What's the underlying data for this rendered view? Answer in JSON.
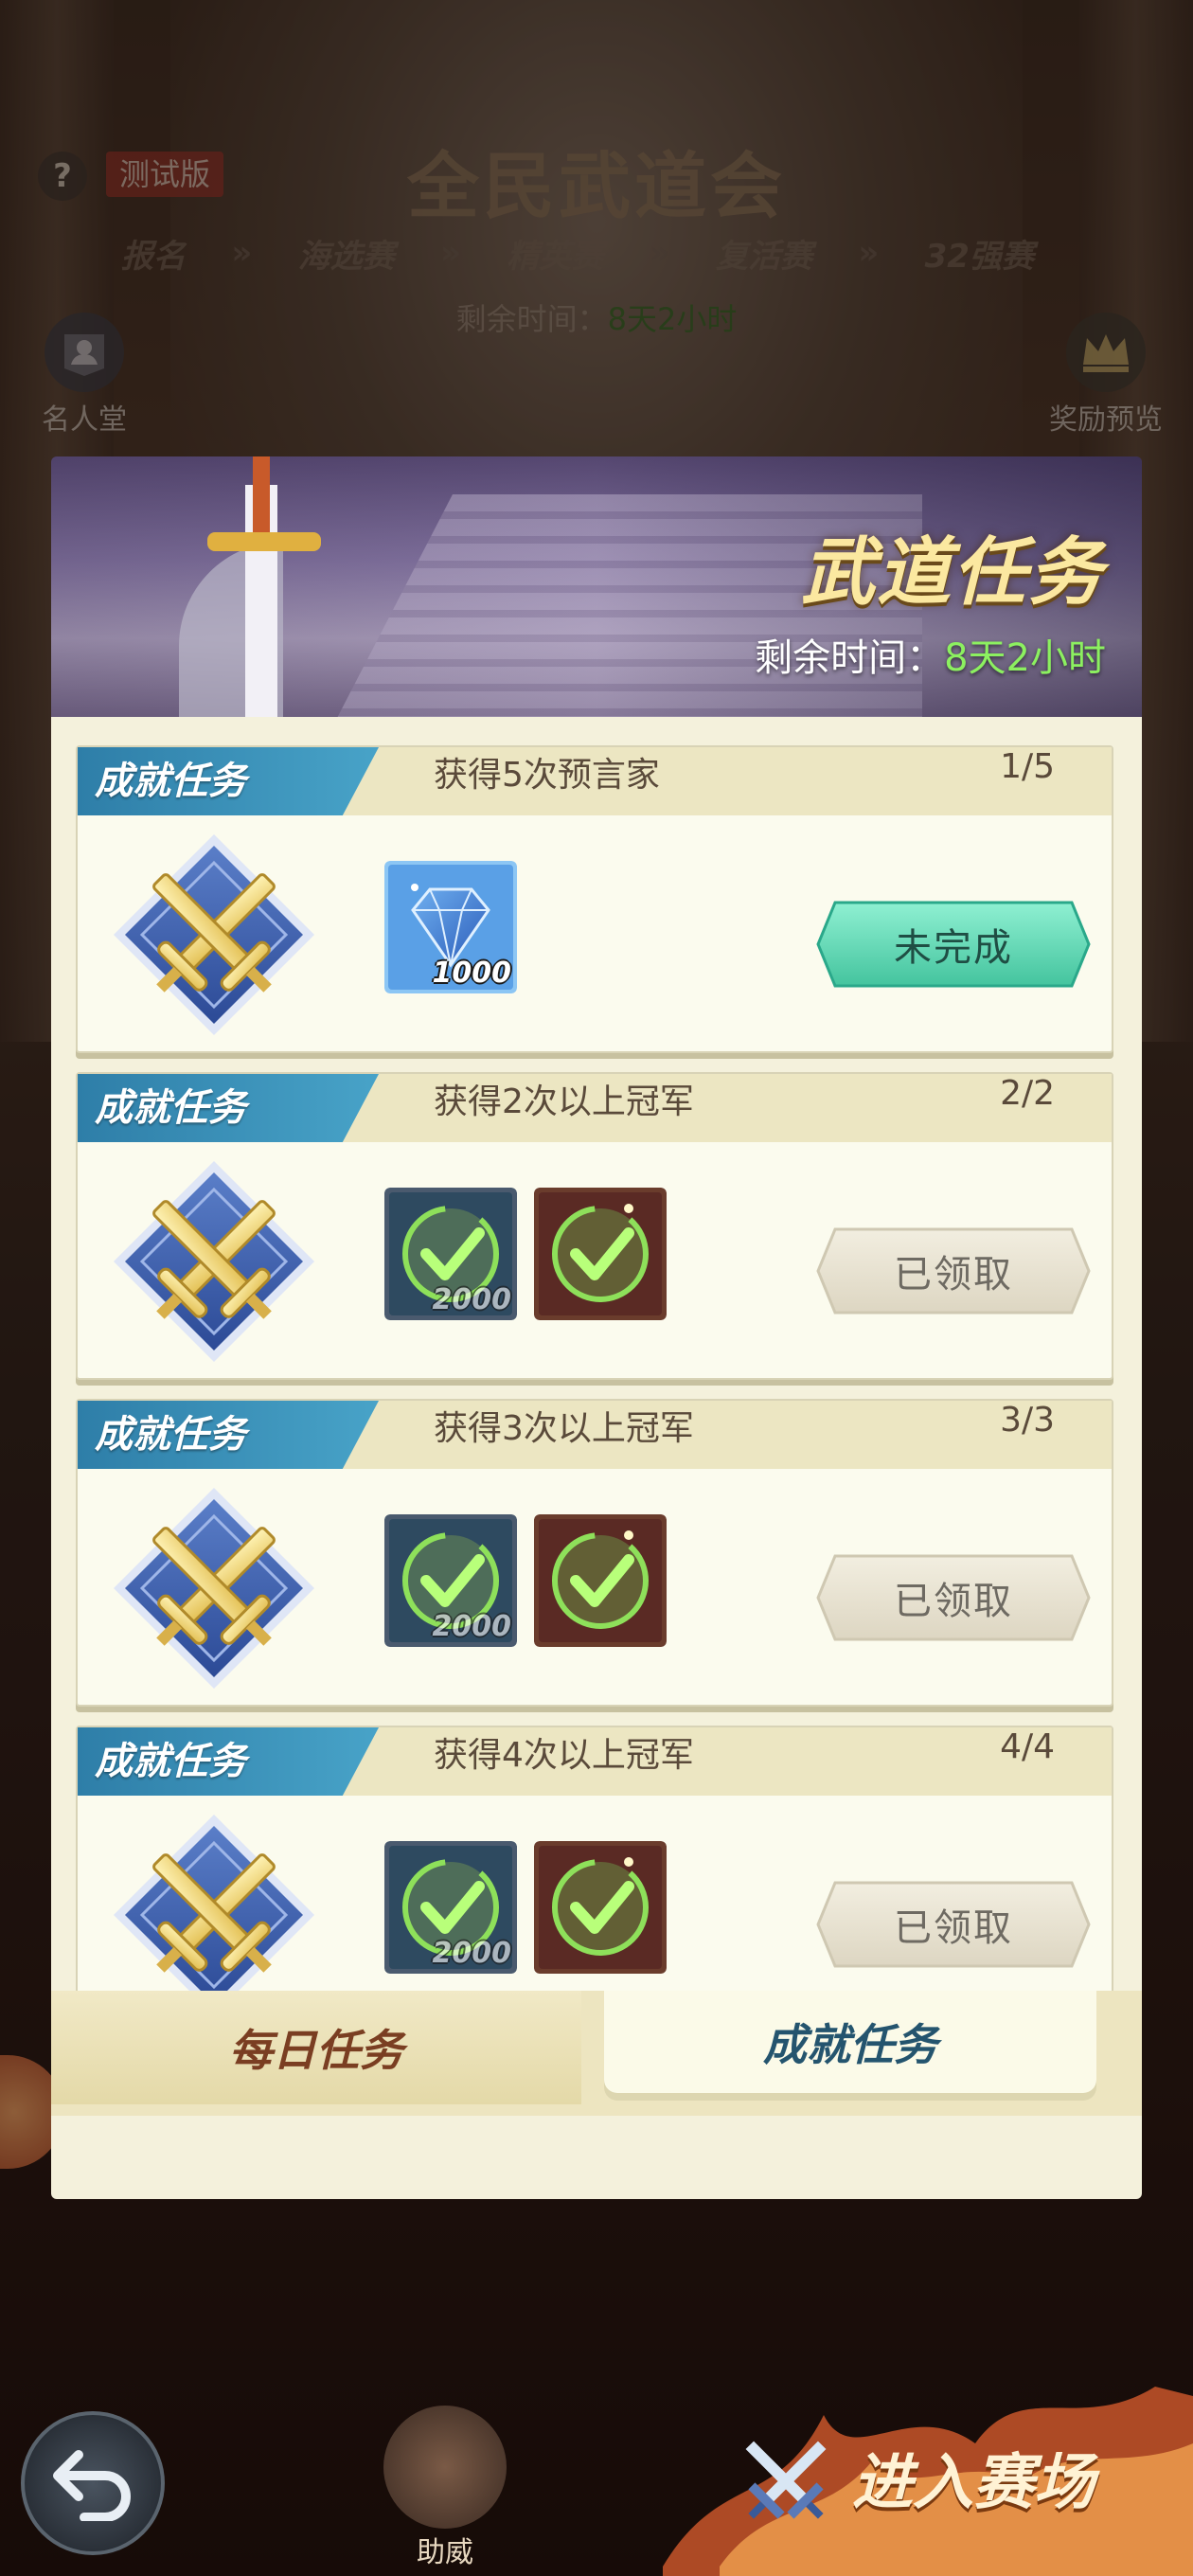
{
  "background": {
    "help_label": "?",
    "test_badge": "测试版",
    "event_title": "全民武道会",
    "stages": [
      "报名",
      "海选赛",
      "精英赛",
      "复活赛",
      "32强赛"
    ],
    "time_label": "剩余时间：",
    "time_value": "8天2小时",
    "left_button": "名人堂",
    "right_button": "奖励预览"
  },
  "modal": {
    "title": "武道任务",
    "time_label": "剩余时间：",
    "time_value": "8天2小时",
    "tasks": [
      {
        "type": "成就任务",
        "description": "获得5次预言家",
        "progress": "1/5",
        "rewards": [
          {
            "icon": "diamond-icon",
            "qty": "1000"
          }
        ],
        "button": "未完成",
        "state": "incomplete"
      },
      {
        "type": "成就任务",
        "description": "获得2次以上冠军",
        "progress": "2/2",
        "rewards": [
          {
            "icon": "claimed-check-icon",
            "qty": "2000"
          },
          {
            "icon": "claimed-check-icon",
            "qty": ""
          }
        ],
        "button": "已领取",
        "state": "claimed"
      },
      {
        "type": "成就任务",
        "description": "获得3次以上冠军",
        "progress": "3/3",
        "rewards": [
          {
            "icon": "claimed-check-icon",
            "qty": "2000"
          },
          {
            "icon": "claimed-check-icon",
            "qty": ""
          }
        ],
        "button": "已领取",
        "state": "claimed"
      },
      {
        "type": "成就任务",
        "description": "获得4次以上冠军",
        "progress": "4/4",
        "rewards": [
          {
            "icon": "claimed-check-icon",
            "qty": "2000"
          },
          {
            "icon": "claimed-check-icon",
            "qty": ""
          }
        ],
        "button": "已领取",
        "state": "claimed"
      }
    ],
    "tabs": {
      "daily": "每日任务",
      "achievement": "成就任务",
      "selected": "achievement"
    }
  },
  "bottom": {
    "cheer_label": "助威",
    "enter_label": "进入赛场"
  },
  "colors": {
    "accent_green": "#8cf060",
    "header_blue": "#2e7ea8",
    "active_button": "#5fd6b8",
    "title_gold": "#fbe8a0"
  }
}
